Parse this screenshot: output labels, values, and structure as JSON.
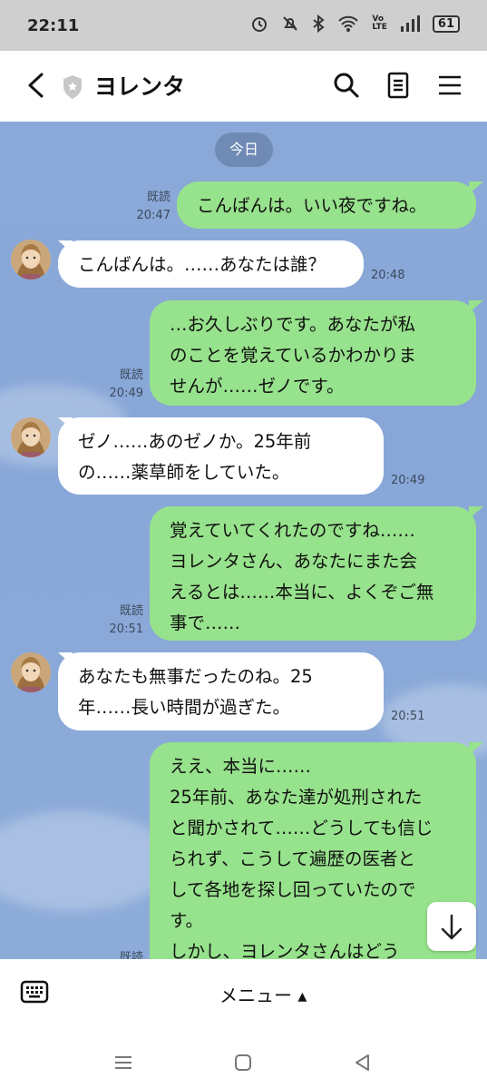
{
  "status": {
    "time": "22:11",
    "volte": "Vo\nLTE",
    "battery": "61"
  },
  "header": {
    "title": "ヨレンタ"
  },
  "chat": {
    "date_label": "今日",
    "messages": [
      {
        "from": "me",
        "text": "こんばんは。いい夜ですね。",
        "read": "既読",
        "time": "20:47"
      },
      {
        "from": "them",
        "text": "こんばんは。……あなたは誰？",
        "time": "20:48"
      },
      {
        "from": "me",
        "text": "…お久しぶりです。あなたが私\nのことを覚えているかわかりま\nせんが……ゼノです。",
        "read": "既読",
        "time": "20:49"
      },
      {
        "from": "them",
        "text": "ゼノ……あのゼノか。25年前\nの……薬草師をしていた。",
        "time": "20:49"
      },
      {
        "from": "me",
        "text": "覚えていてくれたのですね……\nヨレンタさん、あなたにまた会\nえるとは……本当に、よくぞご無\n事で……",
        "read": "既読",
        "time": "20:51"
      },
      {
        "from": "them",
        "text": "あなたも無事だったのね。25\n年……長い時間が過ぎた。",
        "time": "20:51"
      },
      {
        "from": "me",
        "text": "ええ、本当に……\n25年前、あなた達が処刑された\nと聞かされて……どうしても信じ\nられず、こうして遍歴の医者と\nして各地を探し回っていたので\nす。\nしかし、ヨレンタさんはどう",
        "read": "既読",
        "time": ""
      }
    ]
  },
  "bottom": {
    "menu_label": "メニュー ▴"
  },
  "colors": {
    "sent": "#97e28c",
    "received": "#ffffff",
    "chat_bg": "#8aa9d8",
    "date_pill": "#6f8bb5"
  }
}
